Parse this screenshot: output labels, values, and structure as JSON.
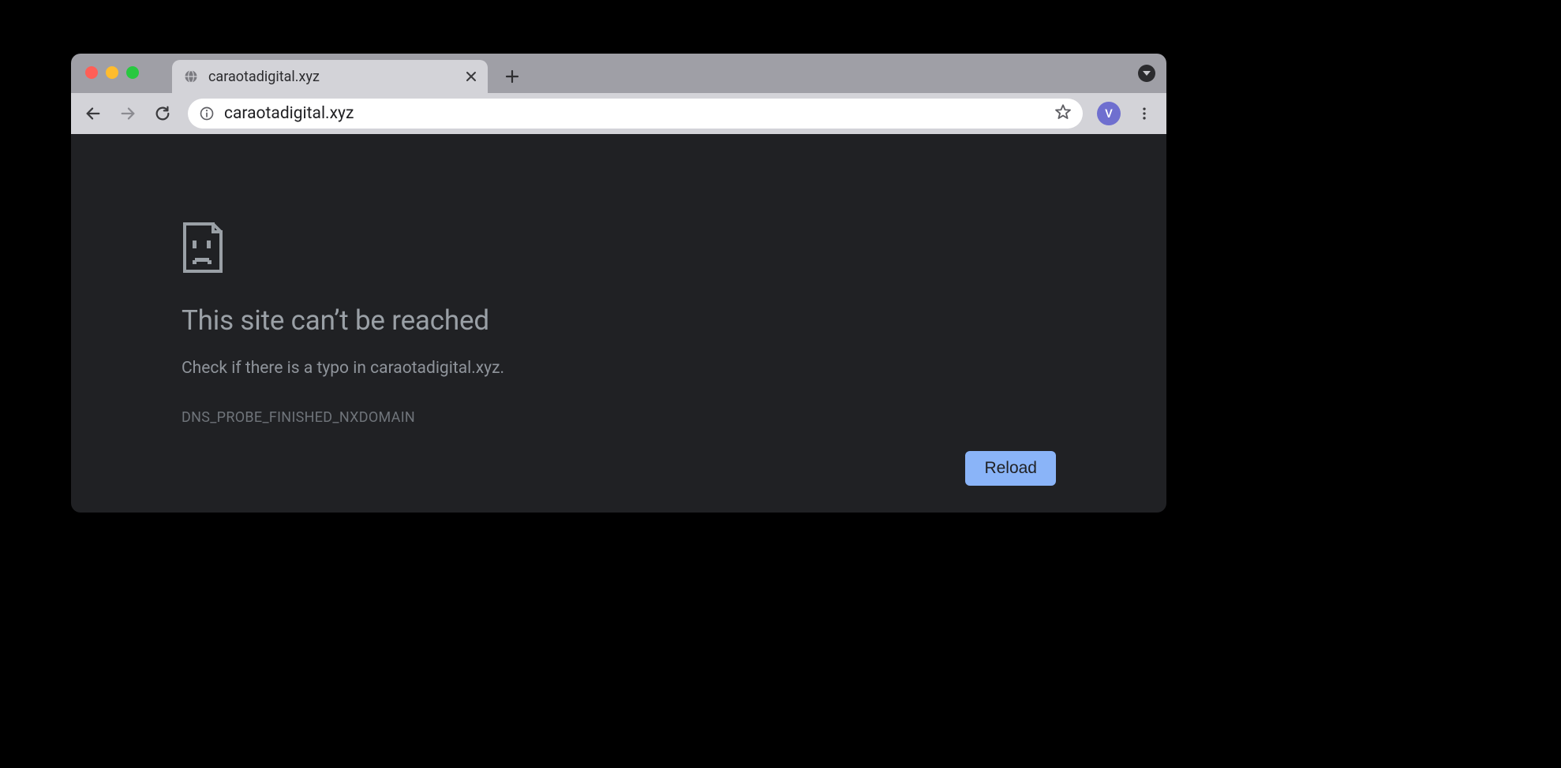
{
  "window": {
    "traffic_lights": [
      "close",
      "minimize",
      "zoom"
    ]
  },
  "tabs": {
    "active": {
      "title": "caraotadigital.xyz"
    }
  },
  "toolbar": {
    "url": "caraotadigital.xyz",
    "profile_initial": "V"
  },
  "error": {
    "title": "This site can’t be reached",
    "message_prefix": "Check if there is a typo in ",
    "message_host": "caraotadigital.xyz",
    "message_suffix": ".",
    "code": "DNS_PROBE_FINISHED_NXDOMAIN",
    "reload_label": "Reload"
  }
}
